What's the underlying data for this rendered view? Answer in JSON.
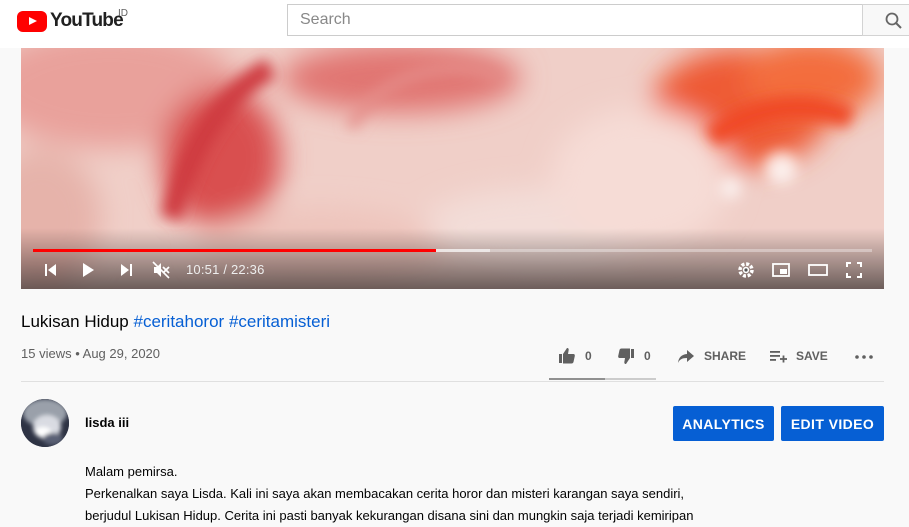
{
  "header": {
    "logo_text": "YouTube",
    "country_code": "ID",
    "search_placeholder": "Search"
  },
  "player": {
    "current_time": "10:51",
    "duration": "22:36",
    "time_display": "10:51 / 22:36",
    "progress_fraction": 0.48,
    "buffered_fraction": 0.545,
    "muted": true
  },
  "video": {
    "title": "Lukisan Hidup",
    "hashtags": [
      "#ceritahoror",
      "#ceritamisteri"
    ],
    "views": "15 views",
    "date": "Aug 29, 2020",
    "likes": "0",
    "dislikes": "0",
    "share_label": "SHARE",
    "save_label": "SAVE"
  },
  "channel": {
    "name": "lisda iii",
    "analytics_label": "ANALYTICS",
    "edit_label": "EDIT VIDEO"
  },
  "description": [
    "Malam pemirsa.",
    "Perkenalkan saya Lisda. Kali ini saya akan membacakan cerita horor dan misteri karangan saya sendiri,",
    "berjudul Lukisan Hidup. Cerita ini pasti banyak kekurangan disana sini dan mungkin saja terjadi kemiripan"
  ],
  "colors": {
    "brand_red": "#ff0000",
    "link_blue": "#065fd4",
    "button_blue": "#065fd4"
  },
  "icons": [
    "youtube-logo-icon",
    "search-icon",
    "previous-icon",
    "play-icon",
    "next-icon",
    "muted-volume-icon",
    "settings-icon",
    "miniplayer-icon",
    "theater-icon",
    "fullscreen-icon",
    "like-icon",
    "dislike-icon",
    "share-icon",
    "save-icon",
    "more-icon"
  ]
}
